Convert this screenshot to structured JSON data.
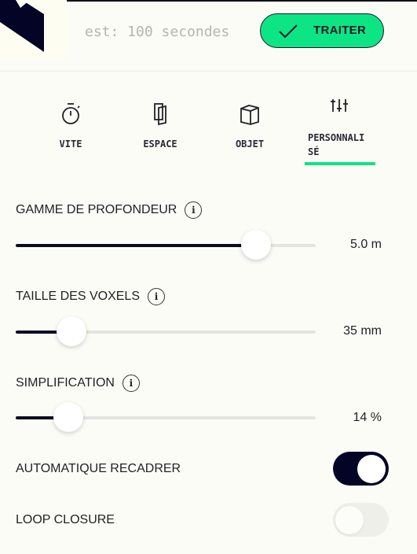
{
  "header": {
    "estimate": "est: 100 secondes",
    "process_label": "TRAITER"
  },
  "tabs": [
    {
      "label": "VITE",
      "icon": "stopwatch-icon"
    },
    {
      "label": "ESPACE",
      "icon": "pages-icon"
    },
    {
      "label": "OBJET",
      "icon": "cube-icon"
    },
    {
      "label": "PERSONNALI\nSÉ",
      "icon": "sliders-icon",
      "active": true
    }
  ],
  "settings": {
    "depth_range": {
      "label": "GAMME DE PROFONDEUR",
      "value": "5.0 m",
      "fraction": 0.8
    },
    "voxel_size": {
      "label": "TAILLE DES VOXELS",
      "value": "35 mm",
      "fraction": 0.185
    },
    "simplification": {
      "label": "SIMPLIFICATION",
      "value": "14 %",
      "fraction": 0.175
    },
    "auto_crop": {
      "label": "AUTOMATIQUE RECADRER",
      "on": true
    },
    "loop_closure": {
      "label": "LOOP CLOSURE",
      "on": false
    }
  },
  "colors": {
    "accent": "#0de584",
    "dark": "#040426",
    "background": "#fcfcf7"
  }
}
